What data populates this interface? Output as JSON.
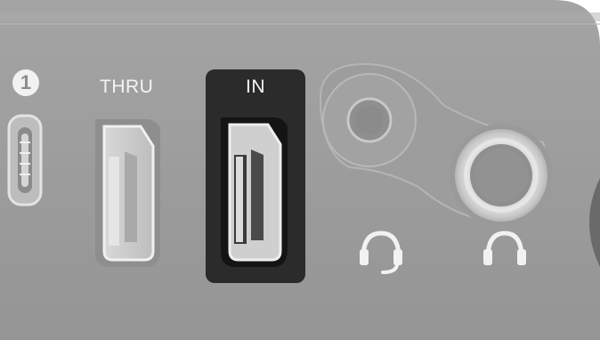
{
  "ports": {
    "badge_number": "1",
    "thru_label": "THRU",
    "in_label": "IN"
  },
  "icons": [
    "usb-c-port-icon",
    "hdmi-port-icon",
    "headset-icon",
    "headphones-icon"
  ],
  "colors": {
    "panel": "#9a9a9a",
    "in_highlight": "#2b2b2b",
    "label": "#f4f4f4"
  }
}
